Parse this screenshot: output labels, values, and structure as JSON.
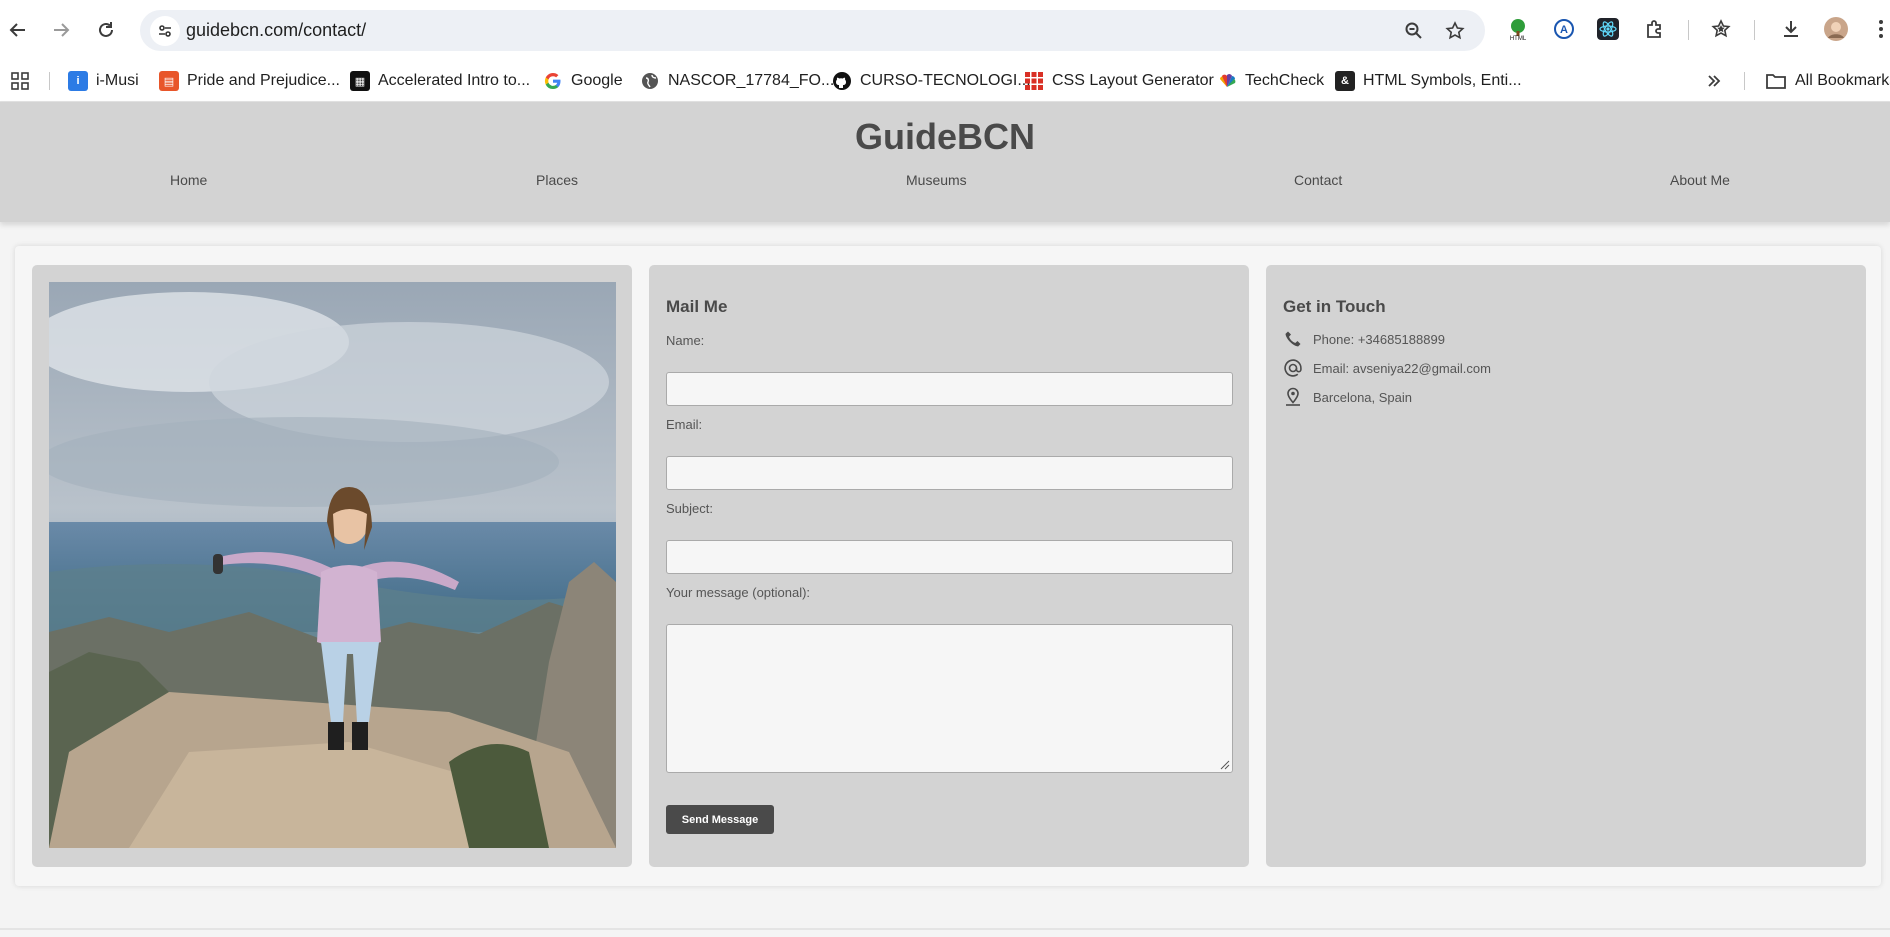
{
  "browser": {
    "url": "guidebcn.com/contact/",
    "bookmarks": [
      {
        "label": "i-Musi",
        "icon": "imusi-icon",
        "color": "#2c7be5"
      },
      {
        "label": "Pride and Prejudice...",
        "icon": "book-icon",
        "color": "#e8562a"
      },
      {
        "label": "Accelerated Intro to...",
        "icon": "grid-logo-icon",
        "color": "#111111"
      },
      {
        "label": "Google",
        "icon": "google-icon",
        "color": "#4285f4"
      },
      {
        "label": "NASCOR_17784_FO...",
        "icon": "globe-icon",
        "color": "#555555"
      },
      {
        "label": "CURSO-TECNOLOGI...",
        "icon": "github-icon",
        "color": "#111111"
      },
      {
        "label": "CSS Layout Generator",
        "icon": "css-grid-icon",
        "color": "#d93025"
      },
      {
        "label": "TechCheck",
        "icon": "nbc-peacock-icon",
        "color": "#f4a300"
      },
      {
        "label": "HTML Symbols, Enti...",
        "icon": "html-symbols-icon",
        "color": "#222222"
      }
    ],
    "all_bookmarks": "All Bookmarks"
  },
  "site": {
    "title": "GuideBCN",
    "nav": [
      "Home",
      "Places",
      "Museums",
      "Contact",
      "About Me"
    ]
  },
  "form": {
    "title": "Mail Me",
    "name_label": "Name:",
    "email_label": "Email:",
    "subject_label": "Subject:",
    "message_label": "Your message (optional):",
    "button": "Send Message"
  },
  "contact": {
    "title": "Get in Touch",
    "phone": "Phone: +34685188899",
    "email": "Email: avseniya22@gmail.com",
    "location": "Barcelona, Spain"
  },
  "colors": {
    "header_bg": "#d3d3d3",
    "button_bg": "#4a4a4a",
    "text": "#4a4a4a"
  }
}
